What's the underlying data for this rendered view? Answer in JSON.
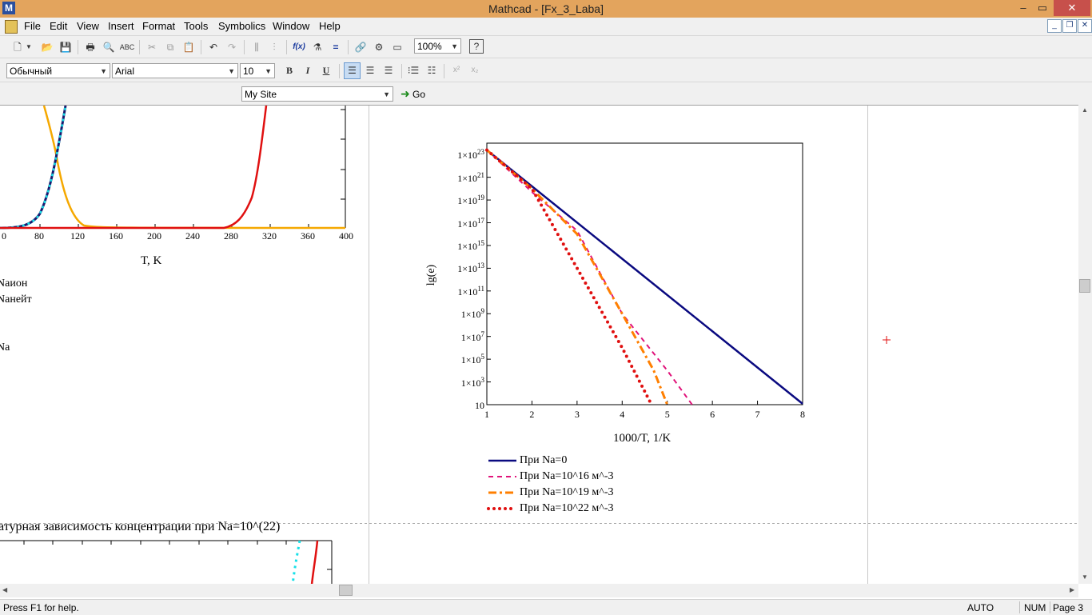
{
  "window": {
    "title": "Mathcad - [Fx_3_Laba]",
    "minimize": "–",
    "restore": "▭",
    "close": "✕"
  },
  "menu": [
    "File",
    "Edit",
    "View",
    "Insert",
    "Format",
    "Tools",
    "Symbolics",
    "Window",
    "Help"
  ],
  "toolbar": {
    "zoom": "100%",
    "style": "Обычный",
    "font": "Arial",
    "size": "10",
    "bold": "B",
    "italic": "I",
    "underline": "U",
    "fx": "f(x)"
  },
  "resources": {
    "site": "My Site",
    "go": "Go"
  },
  "left_plot": {
    "xticks": [
      "0",
      "80",
      "120",
      "160",
      "200",
      "240",
      "280",
      "320",
      "360",
      "400"
    ],
    "xlabel": "T, K",
    "legend_fragments": [
      "Nаион",
      "Nанейт",
      "Na"
    ]
  },
  "main_plot": {
    "ylabel": "lg(e)",
    "xlabel": "1000/T, 1/K",
    "xticks": [
      "1",
      "2",
      "3",
      "4",
      "5",
      "6",
      "7",
      "8"
    ],
    "yticks": [
      {
        "base": "1×10",
        "exp": "23"
      },
      {
        "base": "1×10",
        "exp": "21"
      },
      {
        "base": "1×10",
        "exp": "19"
      },
      {
        "base": "1×10",
        "exp": "17"
      },
      {
        "base": "1×10",
        "exp": "15"
      },
      {
        "base": "1×10",
        "exp": "13"
      },
      {
        "base": "1×10",
        "exp": "11"
      },
      {
        "base": "1×10",
        "exp": "9"
      },
      {
        "base": "1×10",
        "exp": "7"
      },
      {
        "base": "1×10",
        "exp": "5"
      },
      {
        "base": "1×10",
        "exp": "3"
      },
      {
        "base": "10",
        "exp": ""
      }
    ],
    "legend": [
      "При Na=0",
      "При Na=10^16 м^-3",
      "При Na=10^19 м^-3",
      "При Na=10^22 м^-3"
    ],
    "colors": [
      "#0a0a80",
      "#e0147a",
      "#ff7f00",
      "#e01010"
    ]
  },
  "chart_data": {
    "type": "line",
    "title": "",
    "xlabel": "1000/T, 1/K",
    "ylabel": "lg(e)",
    "xlim": [
      1,
      8
    ],
    "ylim": [
      10,
      1e+24
    ],
    "yscale": "log",
    "series": [
      {
        "name": "При Na=0",
        "x": [
          1,
          8
        ],
        "y": [
          2.5e+23,
          12
        ]
      },
      {
        "name": "При Na=10^16 м^-3",
        "x": [
          1,
          2,
          3,
          4,
          5,
          5.55
        ],
        "y": [
          2.5e+23,
          5e+19,
          2e+16,
          1000000000.0,
          10000.0,
          10
        ]
      },
      {
        "name": "При Na=10^19 м^-3",
        "x": [
          1,
          2,
          3,
          4,
          4.7,
          5.0
        ],
        "y": [
          2.5e+23,
          1e+20,
          1e+16,
          1000000000.0,
          10000.0,
          10
        ]
      },
      {
        "name": "При Na=10^22 м^-3",
        "x": [
          1,
          1.5,
          2,
          3,
          4,
          4.65
        ],
        "y": [
          2.5e+23,
          5e+21,
          1e+20,
          10000000000000.0,
          1000000.0,
          10
        ]
      }
    ]
  },
  "bottom_text": "атурная зависимость концентрации при Na=10^(22)",
  "status": {
    "help": "Press F1 for help.",
    "auto": "AUTO",
    "num": "NUM",
    "page": "Page 3"
  }
}
